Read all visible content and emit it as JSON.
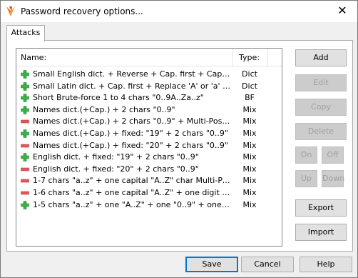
{
  "window": {
    "title": "Password recovery options...",
    "close_glyph": "✕"
  },
  "tabs": [
    {
      "label": "Attacks",
      "active": true
    }
  ],
  "list": {
    "columns": {
      "name": "Name:",
      "type": "Type:"
    },
    "rows": [
      {
        "enabled": true,
        "name": "Small English dict. + Reverse + Cap. first + Cap. all",
        "type": "Dict"
      },
      {
        "enabled": true,
        "name": "Small Latin dict. + Cap. first + Replace 'A' or 'a' with '@'",
        "type": "Dict"
      },
      {
        "enabled": true,
        "name": "Short Brute-force 1 to 4 chars \"0..9A..Za..z\"",
        "type": "BF"
      },
      {
        "enabled": true,
        "name": "Names dict.(+Cap.) + 2 chars \"0..9\"",
        "type": "Mix"
      },
      {
        "enabled": false,
        "name": "Names dict.(+Cap.) + 2 chars \"0..9\" + Multi-Possition ...",
        "type": "Mix"
      },
      {
        "enabled": true,
        "name": "Names dict.(+Cap.) + fixed: \"19\" + 2 chars \"0..9\"",
        "type": "Mix"
      },
      {
        "enabled": false,
        "name": "Names dict.(+Cap.) + fixed: \"20\" + 2 chars \"0..9\"",
        "type": "Mix"
      },
      {
        "enabled": true,
        "name": "English dict. + fixed: \"19\" + 2 chars \"0..9\"",
        "type": "Mix"
      },
      {
        "enabled": false,
        "name": "English dict. + fixed: \"20\" + 2 chars \"0..9\"",
        "type": "Mix"
      },
      {
        "enabled": false,
        "name": "1-7 chars \"a..z\" + one capital \"A..Z\" char Multi-Positio...",
        "type": "Mix"
      },
      {
        "enabled": false,
        "name": "1-6 chars \"a..z\" + one capital \"A..Z\" + one digit \"0..9\"",
        "type": "Mix"
      },
      {
        "enabled": true,
        "name": "1-5 chars \"a..z\" + one \"A..Z\" + one \"0..9\" + one speci...",
        "type": "Mix"
      }
    ]
  },
  "side_buttons": {
    "add": "Add",
    "edit": "Edit",
    "copy": "Copy",
    "delete": "Delete",
    "on": "On",
    "off": "Off",
    "up": "Up",
    "down": "Down",
    "export": "Export",
    "import": "Import"
  },
  "footer": {
    "save": "Save",
    "cancel": "Cancel",
    "help": "Help"
  },
  "colors": {
    "enabled_icon": "#3cb44a",
    "disabled_icon": "#e0585a",
    "focus_border": "#0078d7"
  },
  "icons": {
    "app": "app-logo-icon",
    "enabled": "plus-icon",
    "disabled": "minus-icon"
  }
}
